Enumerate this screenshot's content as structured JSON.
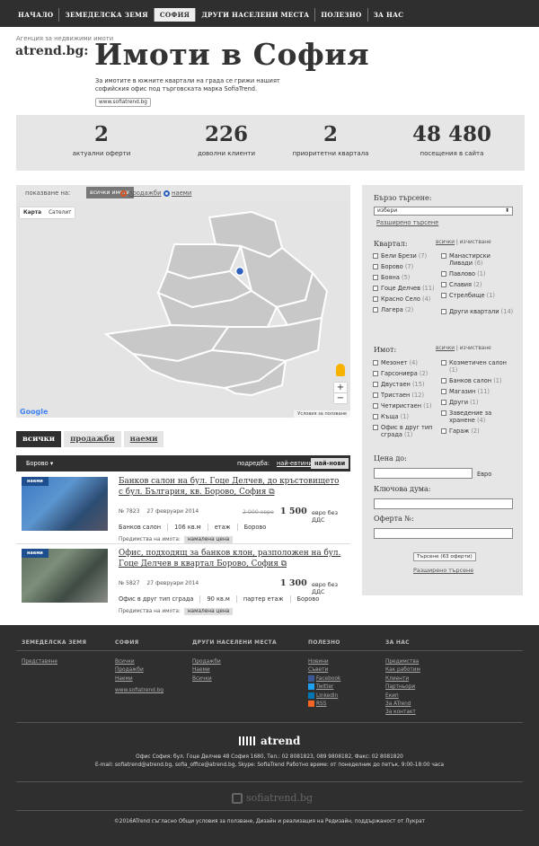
{
  "nav": {
    "items": [
      "НАЧАЛО",
      "ЗЕМЕДЕЛСКА ЗЕМЯ",
      "СОФИЯ",
      "ДРУГИ НАСЕЛЕНИ МЕСТА",
      "ПОЛЕЗНО",
      "ЗА НАС"
    ],
    "active": "СОФИЯ"
  },
  "header": {
    "agency": "Агенция за недвижими имоти",
    "logo": "atrend.bg:",
    "title": "Имоти в София",
    "intro": "За имотите в южните квартали на града се грижи нашият софийския офис под търговската марка SofiaTrend.",
    "site_link": "www.sofiatrend.bg"
  },
  "stats": [
    {
      "value": "2",
      "label": "актуални оферти"
    },
    {
      "value": "226",
      "label": "доволни клиенти"
    },
    {
      "value": "2",
      "label": "приоритетни квартала"
    },
    {
      "value": "48 480",
      "label": "посещения в сайта"
    }
  ],
  "map": {
    "show_label": "показване на:",
    "all_btn": "всички имоти",
    "sale": "продажби",
    "rent": "наеми",
    "type_map": "Карта",
    "type_sat": "Сателит",
    "google": "Google",
    "terms": "Условия за ползване",
    "zoom_in": "+",
    "zoom_out": "−",
    "colors": {
      "sale": "#d9501f",
      "rent": "#2d5fbf",
      "district": "#c9c9c9"
    }
  },
  "tabs": [
    "всички",
    "продажби",
    "наеми"
  ],
  "listbar": {
    "location": "Борово",
    "sort_label": "подредба:",
    "sort_cheap": "най-евтини",
    "sort_new": "най-нови"
  },
  "listings": [
    {
      "tag": "наеми",
      "title": "Банков салон на бул. Гоце Делчев, до кръстовището с бул. България, кв. Борово, София",
      "ref": "№ 7823",
      "date": "27 февруари 2014",
      "old_price": "2 000 евро",
      "price": "1 500",
      "vat": "евро без ДДС",
      "attrs": [
        "Банков салон",
        "106 кв.м",
        "етаж",
        "Борово"
      ],
      "adv_label": "Предимства на имота:",
      "adv_chip": "намалена цена"
    },
    {
      "tag": "наеми",
      "title": "Офис, подходящ за банков клон, разположен на бул. Гоце Делчев в квартал Борово, София",
      "ref": "№ 5827",
      "date": "27 февруари 2014",
      "old_price": "",
      "price": "1 300",
      "vat": "евро без ДДС",
      "attrs": [
        "Офис в друг тип сграда",
        "90 кв.м",
        "партер етаж",
        "Борово"
      ],
      "adv_label": "Предимства на имота:",
      "adv_chip": "намалена цена"
    }
  ],
  "sidebar": {
    "quick": "Бързо търсене:",
    "select": "избери",
    "adv_link": "Разширено търсене",
    "district": "Квартал:",
    "all": "всички",
    "clear": "изчистване",
    "districts_left": [
      {
        "name": "Бели Брези",
        "count": "(7)"
      },
      {
        "name": "Борово",
        "count": "(7)"
      },
      {
        "name": "Бояна",
        "count": "(5)"
      },
      {
        "name": "Гоце Делчев",
        "count": "(11)"
      },
      {
        "name": "Красно Село",
        "count": "(4)"
      },
      {
        "name": "Лагера",
        "count": "(2)"
      }
    ],
    "districts_right": [
      {
        "name": "Манастирски Ливади",
        "count": "(6)"
      },
      {
        "name": "Павлово",
        "count": "(1)"
      },
      {
        "name": "Славия",
        "count": "(2)"
      },
      {
        "name": "Стрелбище",
        "count": "(1)"
      },
      {
        "name": "Други квартали",
        "count": "(14)"
      }
    ],
    "property": "Имот:",
    "props_left": [
      {
        "name": "Мезонет",
        "count": "(4)"
      },
      {
        "name": "Гарсониера",
        "count": "(2)"
      },
      {
        "name": "Двустаен",
        "count": "(15)"
      },
      {
        "name": "Тристаен",
        "count": "(12)"
      },
      {
        "name": "Четиристаен",
        "count": "(1)"
      },
      {
        "name": "Къща",
        "count": "(1)"
      },
      {
        "name": "Офис в друг тип сграда",
        "count": "(1)"
      }
    ],
    "props_right": [
      {
        "name": "Козметичен салон",
        "count": "(1)"
      },
      {
        "name": "Банков салон",
        "count": "(1)"
      },
      {
        "name": "Магазин",
        "count": "(11)"
      },
      {
        "name": "Други",
        "count": "(1)"
      },
      {
        "name": "Заведение за хранене",
        "count": "(4)"
      },
      {
        "name": "Гараж",
        "count": "(2)"
      }
    ],
    "price": "Цена до:",
    "currency": "Евро",
    "keyword": "Ключова дума:",
    "offer": "Оферта №:",
    "search_btn": "Търсене (63 оферти)",
    "adv_link2": "Разширено търсене"
  },
  "footer": {
    "cols": [
      {
        "title": "ЗЕМЕДЕЛСКА ЗЕМЯ",
        "links": [
          "Представяне"
        ]
      },
      {
        "title": "СОФИЯ",
        "links": [
          "Всички",
          "Продажби",
          "Наеми"
        ],
        "extra": "www.sofiatrend.bg"
      },
      {
        "title": "ДРУГИ НАСЕЛЕНИ МЕСТА",
        "links": [
          "Продажби",
          "Наеми",
          "Всички"
        ]
      },
      {
        "title": "ПОЛЕЗНО",
        "links": [
          "Новини",
          "Съвети",
          "Facebook",
          "Twitter",
          "LinkedIn",
          "RSS"
        ]
      },
      {
        "title": "ЗА НАС",
        "links": [
          "Предимства",
          "Как работим",
          "Клиенти",
          "Партньори",
          "Екип",
          "За ATrend",
          "За контакт"
        ]
      }
    ],
    "logo": "atrend",
    "address": "Офис София: бул. Гоце Делчев 48 София 1680, Тел.: 02 8081823, 089 9808182, Факс: 02 8081820",
    "emails": "E-mail: sofiatrend@atrend.bg, sofia_office@atrend.bg, Skype: SofiaTrend Работно време: от понеделник до петък, 9:00-18:00 часа",
    "site": "sofiatrend.bg",
    "copyright": "©2016ATrend съгласно Общи условия за ползване, Дизайн и реализация на Редизайн, поддържаност от Лукрат"
  }
}
